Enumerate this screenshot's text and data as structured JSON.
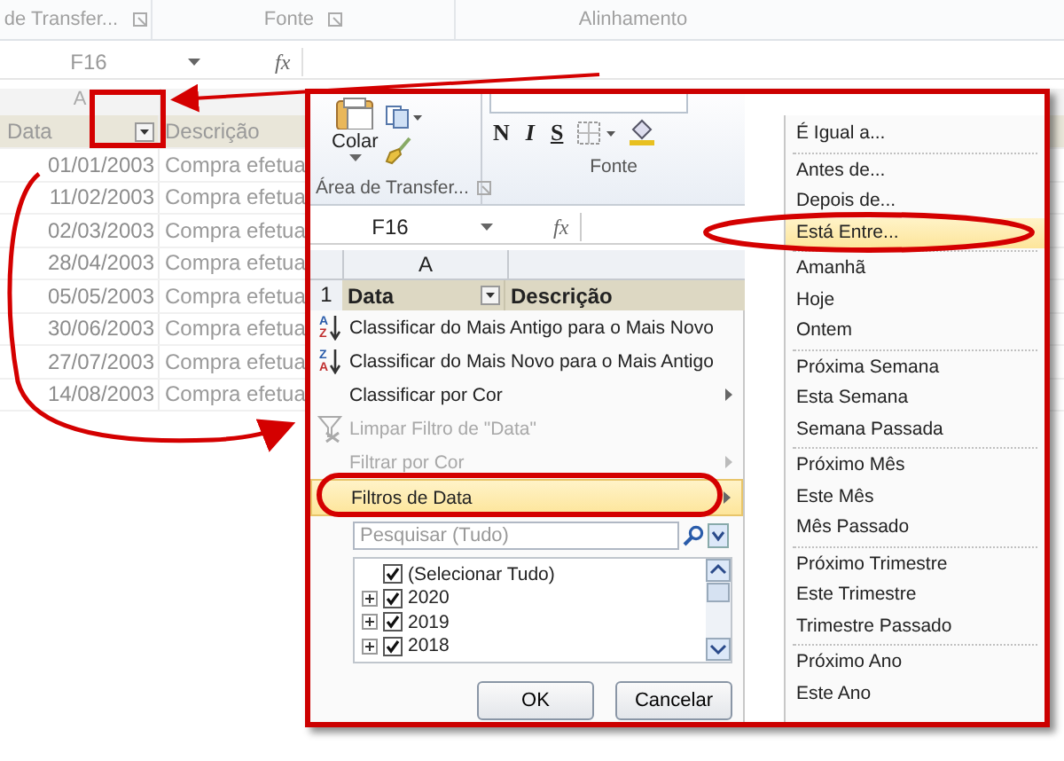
{
  "background_sheet": {
    "ribbon_groups": [
      "de Transfer...",
      "Fonte",
      "Alinhamento"
    ],
    "name_box": "F16",
    "function_symbol": "fx",
    "column_header": "A",
    "header_row": [
      "Data",
      "Descrição"
    ],
    "rows": [
      {
        "date": "01/01/2003",
        "description": "Compra efetua"
      },
      {
        "date": "11/02/2003",
        "description": "Compra efetua"
      },
      {
        "date": "02/03/2003",
        "description": "Compra efetua"
      },
      {
        "date": "28/04/2003",
        "description": "Compra efetua"
      },
      {
        "date": "05/05/2003",
        "description": "Compra efetua"
      },
      {
        "date": "30/06/2003",
        "description": "Compra efetua"
      },
      {
        "date": "27/07/2003",
        "description": "Compra efetua"
      },
      {
        "date": "14/08/2003",
        "description": "Compra efetua"
      }
    ]
  },
  "inset": {
    "ribbon": {
      "paste_label": "Colar",
      "clipboard_group": "Área de Transfer...",
      "font_buttons": [
        "N",
        "I",
        "S"
      ],
      "font_group": "Fonte"
    },
    "name_box": "F16",
    "function_symbol": "fx",
    "column_header": "A",
    "row_number": "1",
    "header_row": [
      "Data",
      "Descrição"
    ],
    "filter_menu": {
      "items": [
        {
          "kind": "sort_asc",
          "icon_letters": [
            "A",
            "Z"
          ],
          "label": "Classificar do Mais Antigo para o Mais Novo",
          "disabled": false,
          "selected": false,
          "submenu": false
        },
        {
          "kind": "sort_desc",
          "icon_letters": [
            "Z",
            "A"
          ],
          "label": "Classificar do Mais Novo para o Mais Antigo",
          "disabled": false,
          "selected": false,
          "submenu": false
        },
        {
          "kind": "plain",
          "label": "Classificar por Cor",
          "disabled": false,
          "selected": false,
          "submenu": true
        },
        {
          "kind": "clear",
          "label": "Limpar Filtro de \"Data\"",
          "disabled": true,
          "selected": false,
          "submenu": false
        },
        {
          "kind": "plain",
          "label": "Filtrar por Cor",
          "disabled": true,
          "selected": false,
          "submenu": true
        },
        {
          "kind": "plain",
          "label": "Filtros de Data",
          "disabled": false,
          "selected": true,
          "submenu": true
        }
      ],
      "search": {
        "placeholder": "Pesquisar (Tudo)"
      },
      "tree": [
        {
          "label": "(Selecionar Tudo)",
          "checked": true,
          "expandable": false
        },
        {
          "label": "2020",
          "checked": true,
          "expandable": true
        },
        {
          "label": "2019",
          "checked": true,
          "expandable": true
        },
        {
          "label": "2018",
          "checked": true,
          "expandable": true
        }
      ],
      "buttons": [
        "OK",
        "Cancelar"
      ]
    },
    "date_filters_submenu": {
      "groups": [
        [
          {
            "label": "É Igual a...",
            "selected": false
          }
        ],
        [
          {
            "label": "Antes de...",
            "selected": false
          },
          {
            "label": "Depois de...",
            "selected": false
          },
          {
            "label": "Está Entre...",
            "selected": true
          }
        ],
        [
          {
            "label": "Amanhã",
            "selected": false
          },
          {
            "label": "Hoje",
            "selected": false
          },
          {
            "label": "Ontem",
            "selected": false
          }
        ],
        [
          {
            "label": "Próxima Semana",
            "selected": false
          },
          {
            "label": "Esta Semana",
            "selected": false
          },
          {
            "label": "Semana Passada",
            "selected": false
          }
        ],
        [
          {
            "label": "Próximo Mês",
            "selected": false
          },
          {
            "label": "Este Mês",
            "selected": false
          },
          {
            "label": "Mês Passado",
            "selected": false
          }
        ],
        [
          {
            "label": "Próximo Trimestre",
            "selected": false
          },
          {
            "label": "Este Trimestre",
            "selected": false
          },
          {
            "label": "Trimestre Passado",
            "selected": false
          }
        ],
        [
          {
            "label": "Próximo Ano",
            "selected": false
          },
          {
            "label": "Este Ano",
            "selected": false
          }
        ]
      ]
    }
  }
}
